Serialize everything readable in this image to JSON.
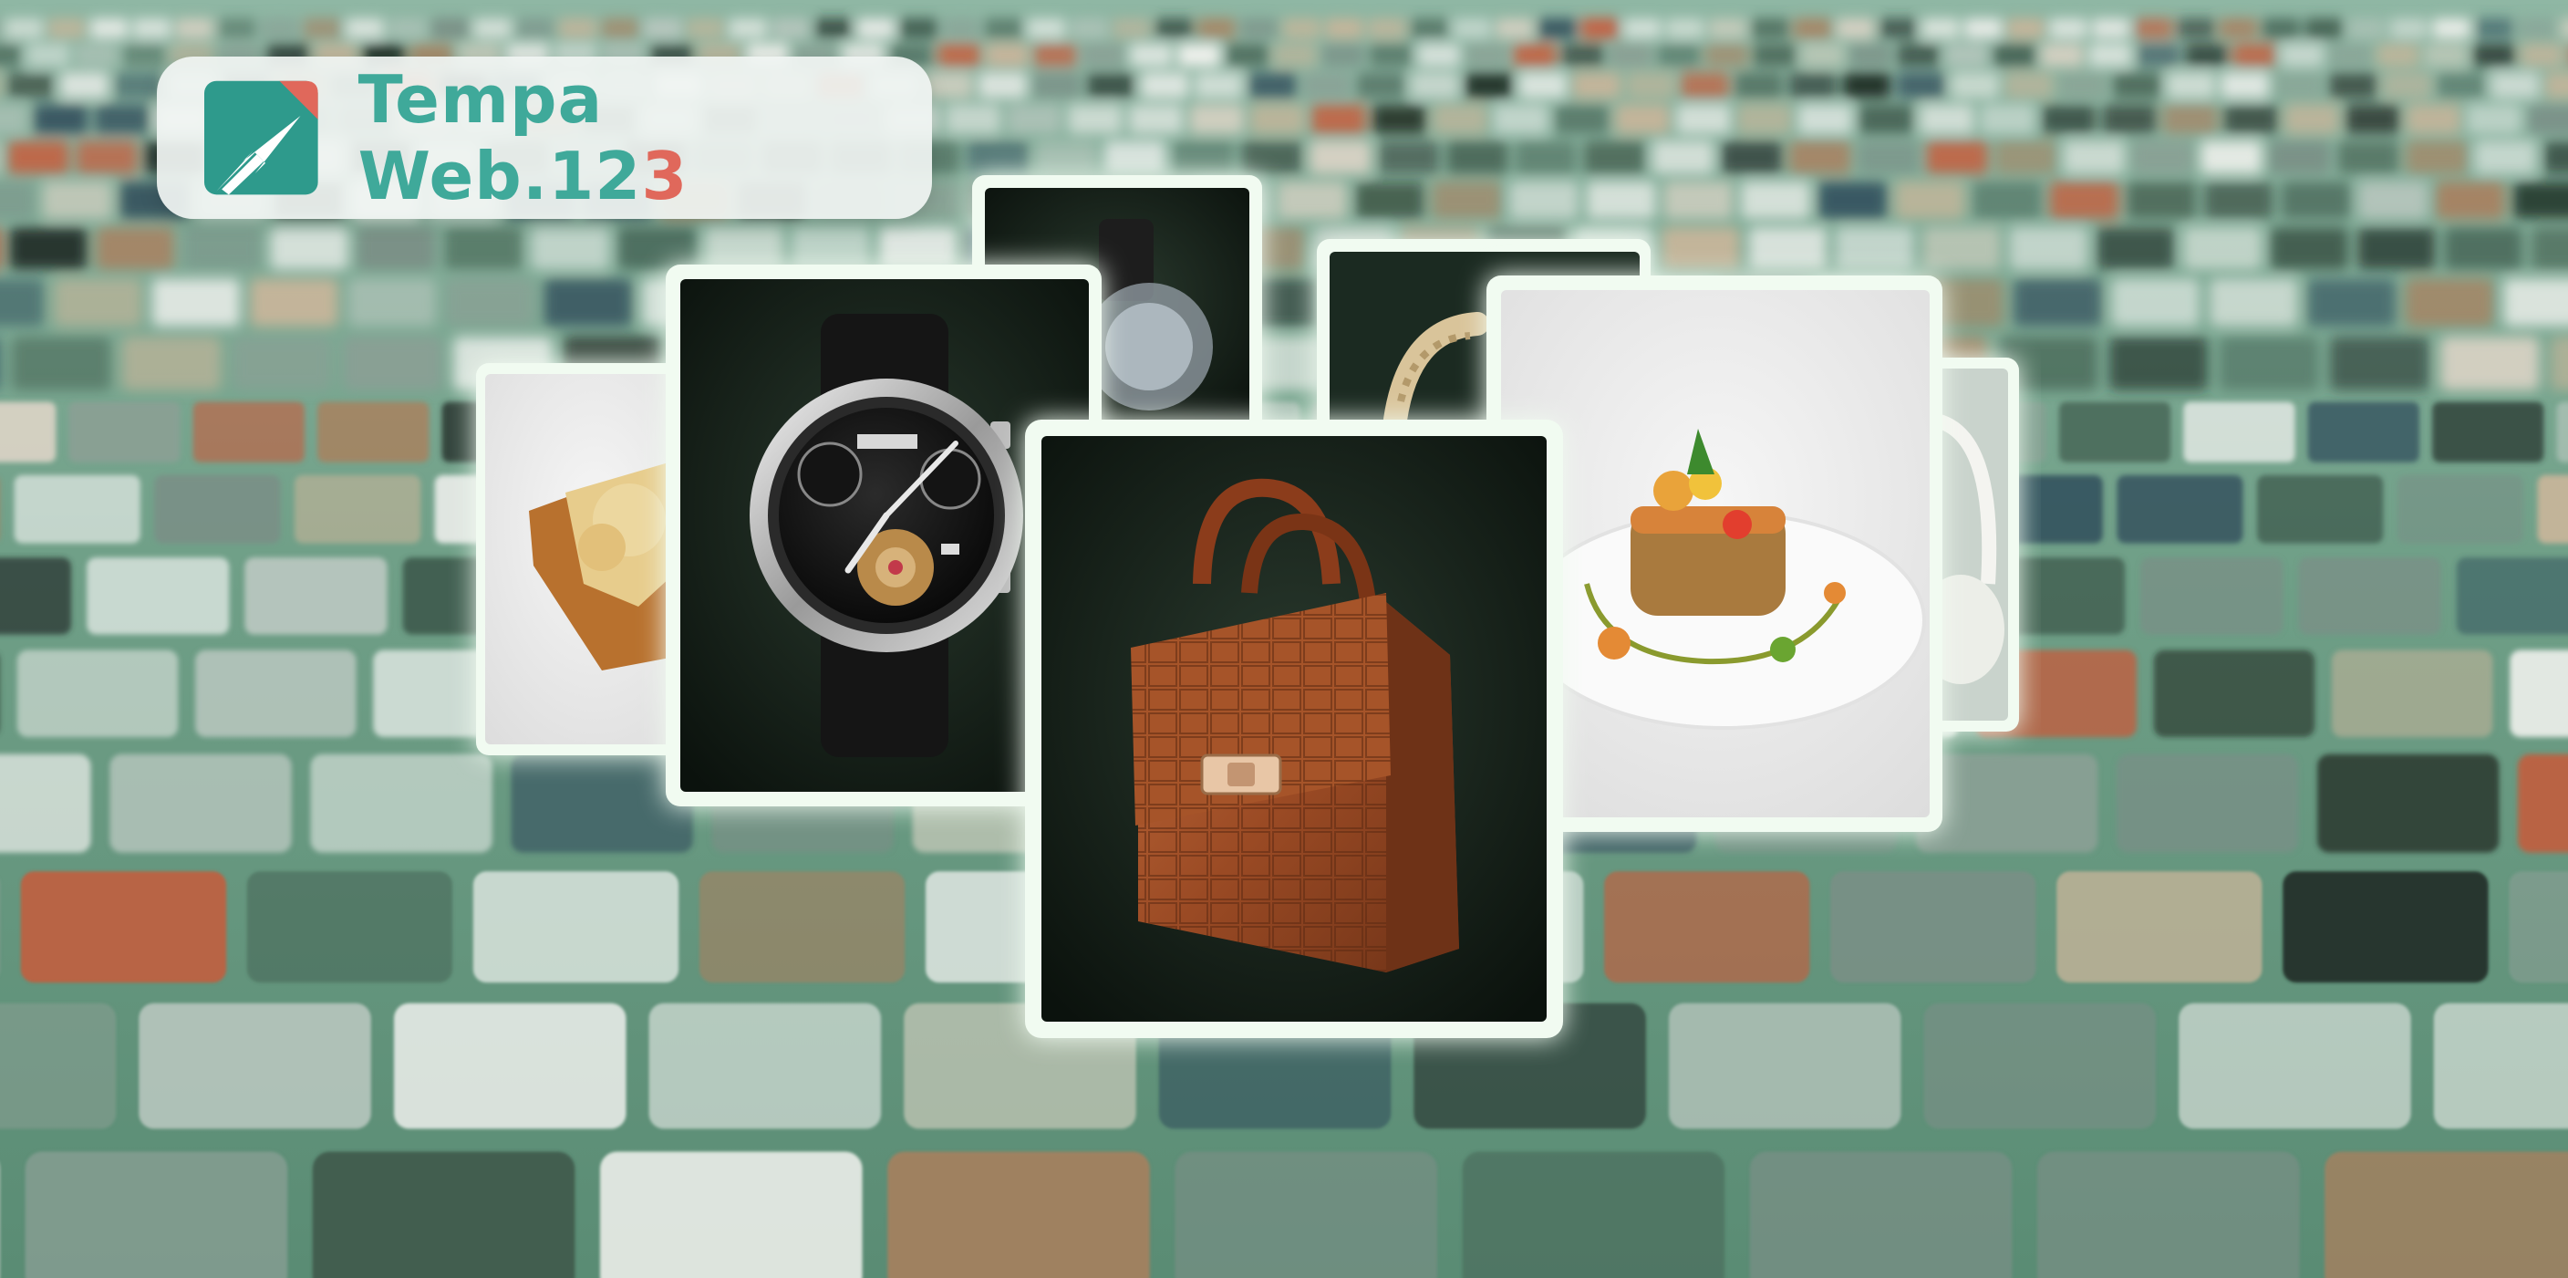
{
  "brand": {
    "name": "Tempa Web.12",
    "accent": "3",
    "colors": {
      "primary": "#3fa99a",
      "accent": "#e0685b"
    }
  },
  "scene": {
    "background_color": "#6f9e86",
    "card_glow_color": "#e6fbe6",
    "cards": [
      {
        "subject": "dessert-slice"
      },
      {
        "subject": "wristwatch"
      },
      {
        "subject": "watch-back"
      },
      {
        "subject": "leather-handbag"
      },
      {
        "subject": "bracelet"
      },
      {
        "subject": "plated-dish"
      },
      {
        "subject": "teapot"
      }
    ]
  }
}
